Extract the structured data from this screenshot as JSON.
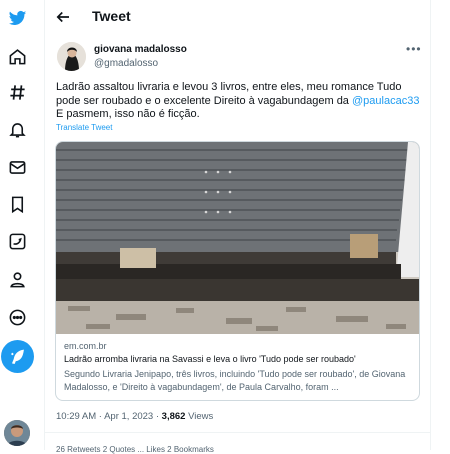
{
  "sidebar": {
    "icons": [
      "twitter-logo-icon",
      "home-icon",
      "explore-hashtag-icon",
      "notifications-bell-icon",
      "messages-envelope-icon",
      "bookmarks-icon",
      "twitter-blue-icon",
      "profile-icon",
      "more-circle-icon",
      "compose-tweet-icon"
    ]
  },
  "header": {
    "title": "Tweet"
  },
  "tweet": {
    "author_name": "giovana madalosso",
    "author_handle": "@gmadalosso",
    "text_part1": "Ladrão assaltou livraria e levou 3 livros, entre eles, meu romance Tudo pode ser roubado e o excelente Direito à vagabundagem da ",
    "mention": "@paulacac33",
    "text_part2": " E pasmem, isso não é ficção.",
    "translate_label": "Translate Tweet",
    "card": {
      "domain": "em.com.br",
      "title": "Ladrão arromba livraria na Savassi e leva o livro 'Tudo pode ser roubado'",
      "description": "Segundo Livraria Jenipapo, três livros, incluindo 'Tudo pode ser roubado', de Giovana Madalosso, e 'Direito à vagabundagem', de Paula Carvalho, foram ..."
    },
    "time": "10:29 AM",
    "separator": "·",
    "date": "Apr 1, 2023",
    "views_count": "3,862",
    "views_label": "Views",
    "stats_partial": "26 Retweets   2 Quotes   ...   Likes   2 Bookmarks"
  },
  "colors": {
    "accent": "#1d9bf0",
    "text": "#0f1419",
    "muted": "#536471",
    "border": "#cfd9de"
  }
}
